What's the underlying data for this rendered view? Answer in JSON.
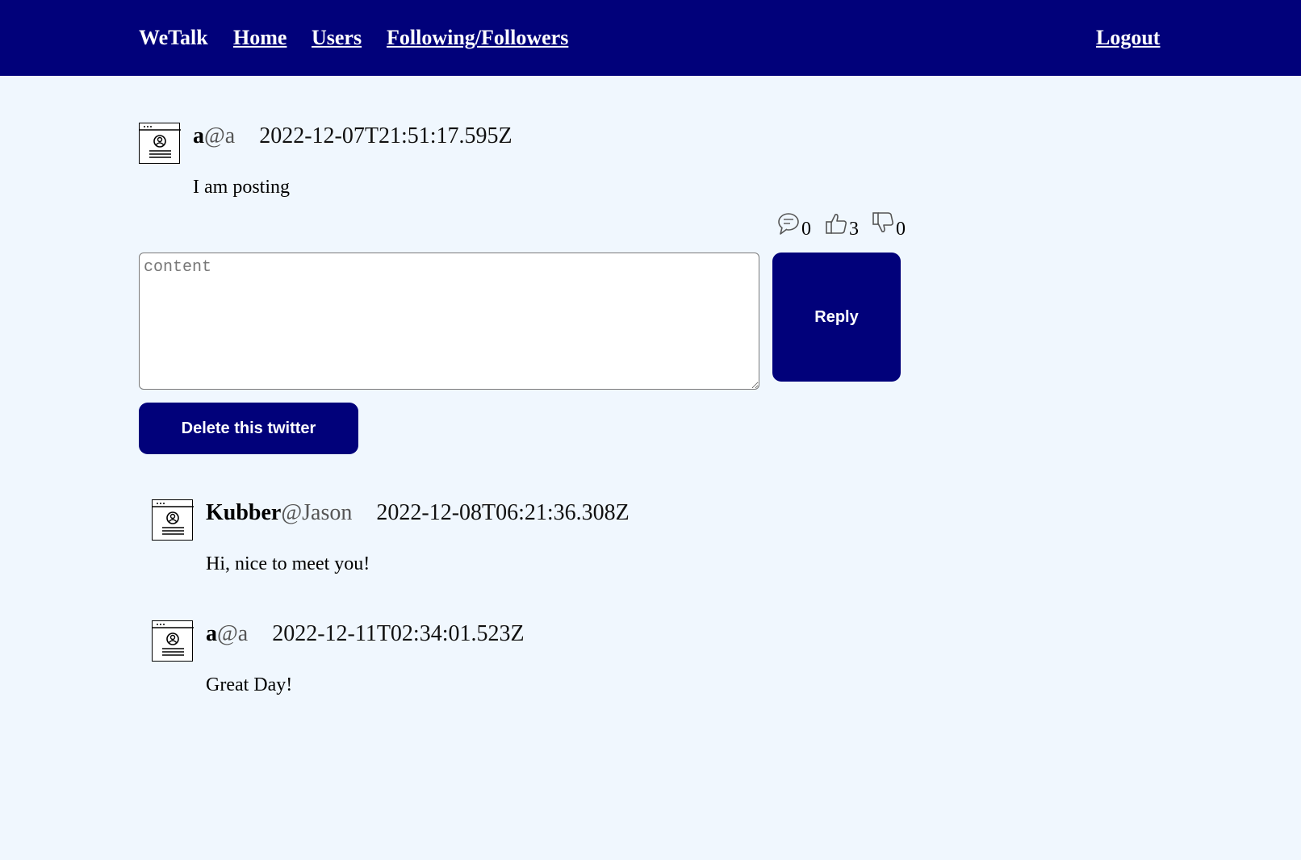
{
  "nav": {
    "brand": "WeTalk",
    "home": "Home",
    "users": "Users",
    "follow": "Following/Followers",
    "logout": "Logout",
    "background": "#01017a"
  },
  "post": {
    "name": "a",
    "handle": "@a",
    "time": "2022-12-07T21:51:17.595Z",
    "content": "I am posting",
    "comments": "0",
    "likes": "3",
    "dislikes": "0"
  },
  "reply": {
    "placeholder": "content",
    "button": "Reply"
  },
  "delete_button": "Delete this twitter",
  "replies": [
    {
      "name": "Kubber",
      "handle": "@Jason",
      "time": "2022-12-08T06:21:36.308Z",
      "content": "Hi, nice to meet you!"
    },
    {
      "name": "a",
      "handle": "@a",
      "time": "2022-12-11T02:34:01.523Z",
      "content": "Great Day!"
    }
  ],
  "icons": {
    "avatar": "user-profile-icon",
    "comment": "comment-bubble-icon",
    "like": "thumbs-up-icon",
    "dislike": "thumbs-down-icon"
  },
  "colors": {
    "accent": "#01017a",
    "page_background": "#f0f7fe"
  }
}
